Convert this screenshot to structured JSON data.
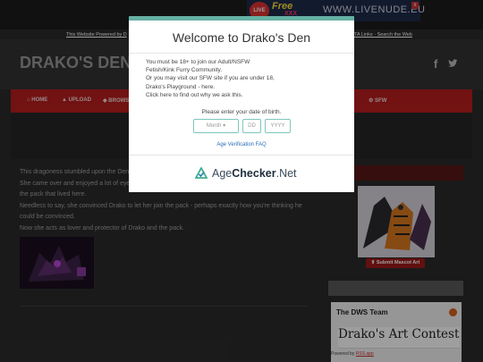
{
  "banner": {
    "live_badge": "LIVE",
    "free_label": "Free",
    "xxx_label": "XXX",
    "url": "WWW.LIVENUDE.EU",
    "ad_close": "x"
  },
  "header": {
    "powered_by": "This Website Powered by D",
    "links": "TA Links · Search the Web",
    "site_title": "DRAKO'S DEN",
    "social": {
      "facebook": "f",
      "twitter": "❝"
    }
  },
  "nav": {
    "items": [
      {
        "label": "⌂ HOME"
      },
      {
        "label": "▲ UPLOAD"
      },
      {
        "label": "◆ BROWS"
      },
      {
        "label": "⚙ SFW"
      }
    ]
  },
  "content": {
    "paragraphs": [
      "This dragoness stumbled upon the Den",
      "She came over and enjoyed a lot of eye",
      "the pack that lived here.",
      "Needless to say, she convinced Drako to let her join the pack - perhaps exactly how you're thinking he",
      "could be convinced.",
      "Now she acts as lover and protector of Drako and the pack."
    ]
  },
  "sidebar": {
    "header1": "",
    "submit_button": "⬆ Submit Mascot Art",
    "header2": "",
    "dws_title": "The DWS Team",
    "art_contest": "Drako's Art Contest",
    "footer_prefix": "Powered by ",
    "footer_link": "RSS.app"
  },
  "modal": {
    "title": "Welcome to Drako's Den",
    "body_lines": [
      "You must be 18+ to join our Adult/NSFW",
      "Fetish/Kink Furry Community.",
      "Or you may visit our SFW site if you are under 18,",
      "Drako's Playground - here.",
      "Click here to find out why we ask this."
    ],
    "dob_prompt": "Please enter your date of birth.",
    "month_placeholder": "Month",
    "day_placeholder": "DD",
    "year_placeholder": "YYYY",
    "faq_link": "Age Verification FAQ",
    "brand_prefix": "Age",
    "brand_bold": "Checker",
    "brand_suffix": ".Net"
  },
  "colors": {
    "nav_red": "#b81d1d",
    "modal_accent": "#66b0a3",
    "brand_green": "#3fae8c"
  }
}
